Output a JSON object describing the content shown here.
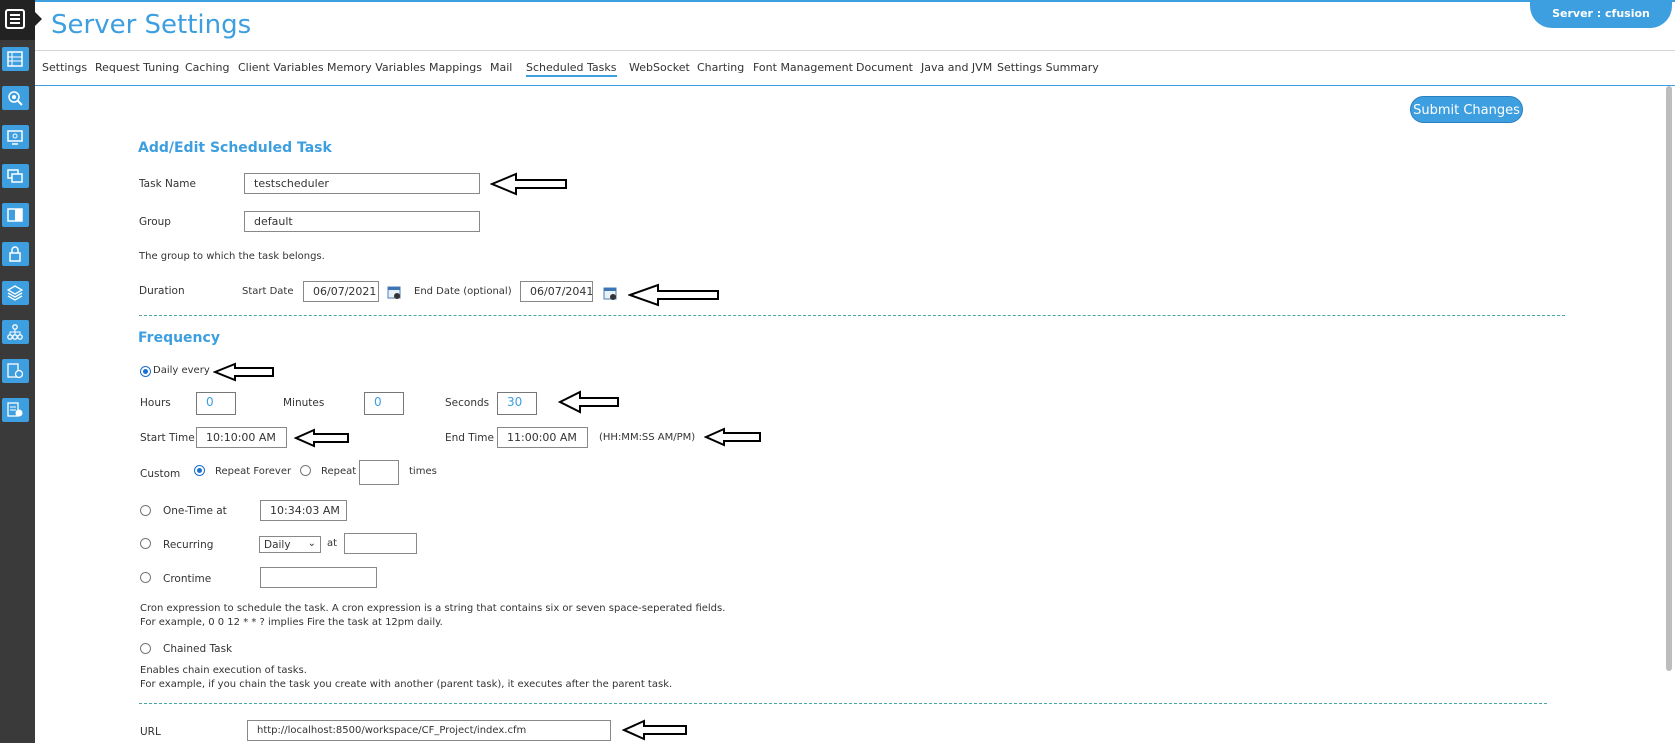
{
  "header": {
    "title": "Server Settings",
    "server_badge": "Server : cfusion"
  },
  "tabs": [
    {
      "label": "Settings"
    },
    {
      "label": "Request Tuning"
    },
    {
      "label": "Caching"
    },
    {
      "label": "Client Variables"
    },
    {
      "label": "Memory Variables"
    },
    {
      "label": "Mappings"
    },
    {
      "label": "Mail"
    },
    {
      "label": "Scheduled Tasks",
      "active": true
    },
    {
      "label": "WebSocket"
    },
    {
      "label": "Charting"
    },
    {
      "label": "Font Management"
    },
    {
      "label": "Document"
    },
    {
      "label": "Java and JVM"
    },
    {
      "label": "Settings Summary"
    }
  ],
  "submit_label": "Submit Changes",
  "form": {
    "heading": "Add/Edit Scheduled Task",
    "task_name_label": "Task Name",
    "task_name_value": "testscheduler",
    "group_label": "Group",
    "group_value": "default",
    "group_help": "The group to which the task belongs.",
    "duration_label": "Duration",
    "start_date_label": "Start Date",
    "start_date_value": "06/07/2021",
    "end_date_label": "End Date (optional)",
    "end_date_value": "06/07/2041"
  },
  "frequency": {
    "heading": "Frequency",
    "daily_every_label": "Daily every",
    "daily_every_selected": true,
    "hours_label": "Hours",
    "hours_value": "0",
    "minutes_label": "Minutes",
    "minutes_value": "0",
    "seconds_label": "Seconds",
    "seconds_value": "30",
    "start_time_label": "Start Time",
    "start_time_value": "10:10:00 AM",
    "end_time_label": "End Time",
    "end_time_value": "11:00:00 AM",
    "time_format_hint": "(HH:MM:SS AM/PM)",
    "custom_label": "Custom",
    "repeat_forever_label": "Repeat Forever",
    "repeat_forever_selected": true,
    "repeat_label": "Repeat",
    "repeat_value": "",
    "times_label": "times",
    "one_time_label": "One-Time at",
    "one_time_value": "10:34:03 AM",
    "recurring_label": "Recurring",
    "recurring_select": "Daily",
    "at_label": "at",
    "recurring_at_value": "",
    "crontime_label": "Crontime",
    "crontime_value": "",
    "cron_help_1": "Cron expression to schedule the task. A cron expression is a string that contains six or seven space-seperated fields.",
    "cron_help_2": "For example, 0 0 12 * * ? implies Fire the task at 12pm daily.",
    "chained_label": "Chained Task",
    "chained_help_1": "Enables chain execution of tasks.",
    "chained_help_2": "For example, if you chain the task you create with another (parent task), it executes after the parent task."
  },
  "url": {
    "label": "URL",
    "value": "http://localhost:8500/workspace/CF_Project/index.cfm"
  },
  "icons": [
    "menu-icon",
    "server-settings-icon",
    "data-services-icon",
    "debugging-icon",
    "server-monitoring-icon",
    "extensions-icon",
    "security-icon",
    "packaging-icon",
    "enterprise-manager-icon",
    "event-gateways-icon",
    "cloud-services-icon",
    "calendar-icon",
    "arrow-icon"
  ],
  "colors": {
    "accent": "#3d9fe0",
    "rail": "#3a3a3a",
    "divider": "#45a8a0"
  }
}
